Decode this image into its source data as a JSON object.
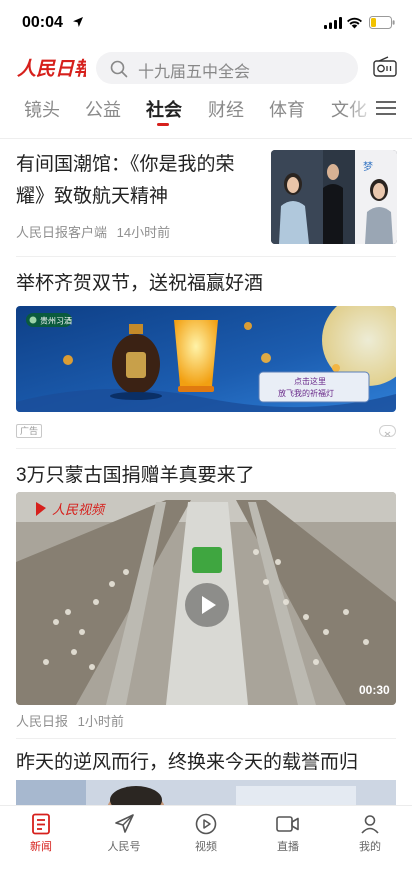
{
  "status_bar": {
    "time": "00:04"
  },
  "header": {
    "logo_text": "人民日報",
    "search_placeholder": "十九届五中全会"
  },
  "tabs": [
    {
      "label": "镜头",
      "active": false
    },
    {
      "label": "公益",
      "active": false
    },
    {
      "label": "社会",
      "active": true
    },
    {
      "label": "财经",
      "active": false
    },
    {
      "label": "体育",
      "active": false
    },
    {
      "label": "文化",
      "active": false
    }
  ],
  "articles": [
    {
      "title": "有间国潮馆：《你是我的荣耀》致敬航天精神",
      "source": "人民日报客户端",
      "time": "14小时前"
    },
    {
      "title": "举杯齐贺双节，送祝福赢好酒",
      "ad_label": "广告",
      "banner": {
        "brand": "贵州习酒",
        "lantern_text": "点击这里",
        "lantern_subtext": "放飞我的祈福灯"
      }
    },
    {
      "title": "3万只蒙古国捐赠羊真要来了",
      "duration": "00:30",
      "source": "人民日报",
      "time": "1小时前",
      "watermark": "人民视频"
    },
    {
      "title": "昨天的逆风而行，终换来今天的载誉而归"
    }
  ],
  "bottom_nav": [
    {
      "label": "新闻",
      "icon": "news-icon",
      "active": true
    },
    {
      "label": "人民号",
      "icon": "paper-plane-icon",
      "active": false
    },
    {
      "label": "视频",
      "icon": "play-circle-icon",
      "active": false
    },
    {
      "label": "直播",
      "icon": "video-camera-icon",
      "active": false
    },
    {
      "label": "我的",
      "icon": "profile-icon",
      "active": false
    }
  ],
  "colors": {
    "accent": "#d6201c",
    "text": "#222222",
    "muted": "#8f8f8f"
  }
}
